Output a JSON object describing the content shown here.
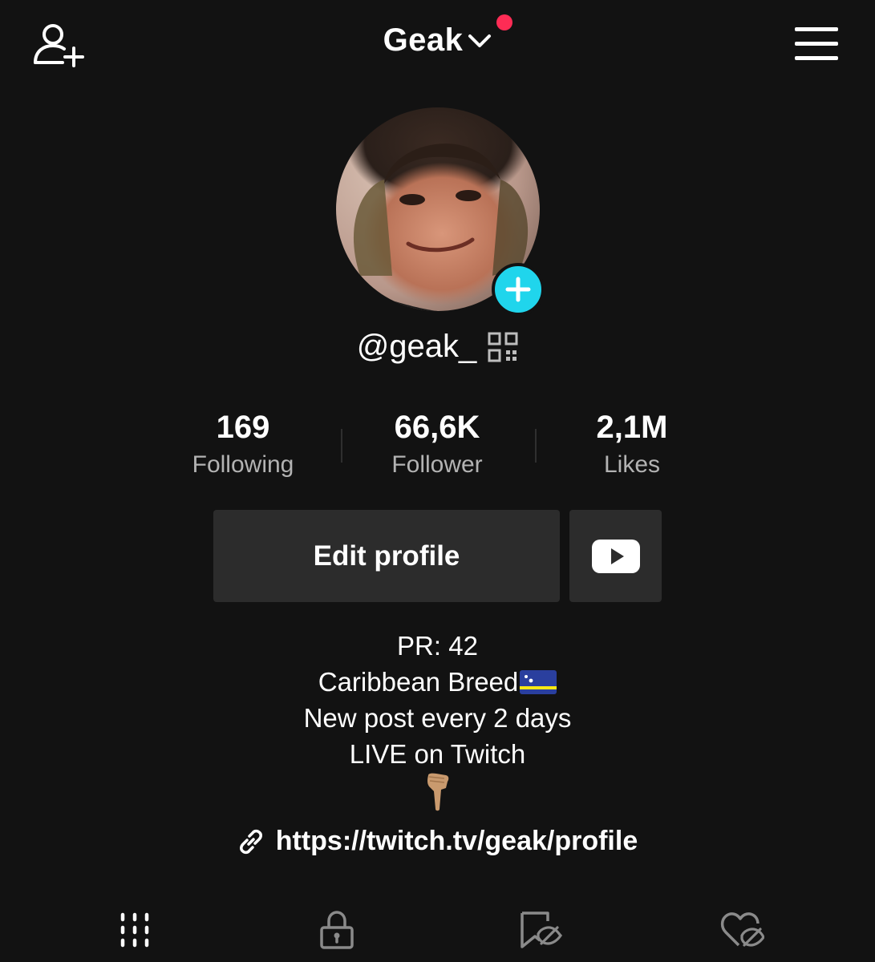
{
  "header": {
    "title": "Geak",
    "icons": {
      "left": "add-user-icon",
      "title_arrow": "chevron-down-icon",
      "right": "menu-icon"
    },
    "notif_color": "#fe2c55"
  },
  "profile": {
    "username": "@geak_",
    "plus_color": "#20d5ec",
    "stats": [
      {
        "value": "169",
        "label": "Following"
      },
      {
        "value": "66,6K",
        "label": "Follower"
      },
      {
        "value": "2,1M",
        "label": "Likes"
      }
    ],
    "edit_label": "Edit profile",
    "bio": [
      "PR: 42",
      "Caribbean Breed",
      "New post every 2 days",
      "LIVE on Twitch"
    ],
    "link": "https://twitch.tv/geak/profile"
  },
  "tabs": [
    "videos-grid-icon",
    "lock-icon",
    "bookmark-hidden-icon",
    "heart-hidden-icon"
  ],
  "colors": {
    "background": "#121212",
    "button": "#2c2c2c",
    "muted_text": "#b3b3b3"
  }
}
